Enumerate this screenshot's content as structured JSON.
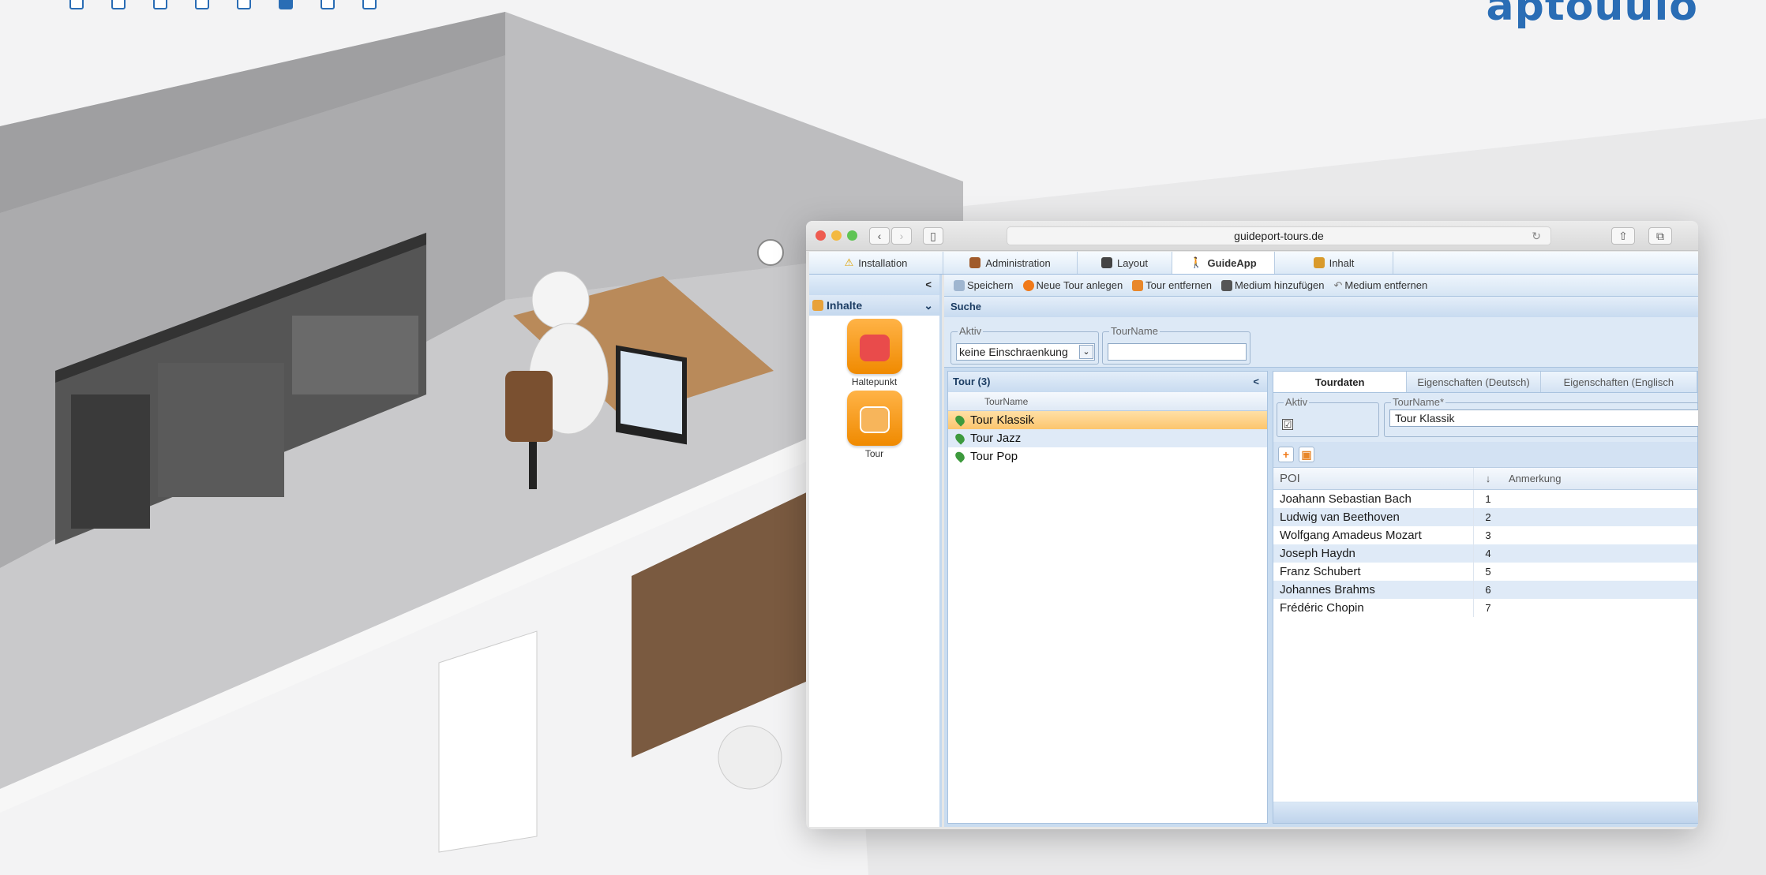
{
  "page": {
    "brand": "aptouuio",
    "progress_dots": {
      "total": 8,
      "active_index": 5
    }
  },
  "browser": {
    "url": "guideport-tours.de"
  },
  "app_tabs": [
    {
      "label": "Installation",
      "icon": "warning-icon"
    },
    {
      "label": "Administration",
      "icon": "admin-icon"
    },
    {
      "label": "Layout",
      "icon": "layout-icon"
    },
    {
      "label": "GuideApp",
      "icon": "guideapp-icon",
      "selected": true
    },
    {
      "label": "Inhalt",
      "icon": "inhalt-icon"
    }
  ],
  "sidebar": {
    "collapse": "<",
    "section": "Inhalte",
    "items": [
      {
        "label": "Haltepunkt",
        "icon": "haltepunkt-icon"
      },
      {
        "label": "Tour",
        "icon": "tour-map-icon"
      }
    ]
  },
  "toolbar": {
    "save": "Speichern",
    "new_tour": "Neue Tour anlegen",
    "remove_tour": "Tour entfernen",
    "add_media": "Medium hinzufügen",
    "remove_media": "Medium entfernen"
  },
  "search": {
    "title": "Suche",
    "aktiv_label": "Aktiv",
    "aktiv_value": "keine Einschraenkung",
    "tourname_label": "TourName",
    "tourname_value": ""
  },
  "tour_list": {
    "title": "Tour (3)",
    "collapse": "<",
    "column": "TourName",
    "rows": [
      "Tour Klassik",
      "Tour Jazz",
      "Tour Pop"
    ],
    "selected_index": 0
  },
  "detail": {
    "tabs": [
      "Tourdaten",
      "Eigenschaften (Deutsch)",
      "Eigenschaften (Englisch"
    ],
    "aktiv_label": "Aktiv",
    "aktiv_checked": "☑",
    "tourname_label": "TourName*",
    "tourname_value": "Tour Klassik",
    "poi_columns": [
      "POI",
      "↓",
      "Anmerkung"
    ],
    "poi_rows": [
      {
        "poi": "Joahann Sebastian Bach",
        "order": "1",
        "note": ""
      },
      {
        "poi": "Ludwig van Beethoven",
        "order": "2",
        "note": ""
      },
      {
        "poi": "Wolfgang Amadeus Mozart",
        "order": "3",
        "note": ""
      },
      {
        "poi": "Joseph Haydn",
        "order": "4",
        "note": ""
      },
      {
        "poi": "Franz Schubert",
        "order": "5",
        "note": ""
      },
      {
        "poi": "Johannes Brahms",
        "order": "6",
        "note": ""
      },
      {
        "poi": "Frédéric Chopin",
        "order": "7",
        "note": ""
      }
    ]
  }
}
